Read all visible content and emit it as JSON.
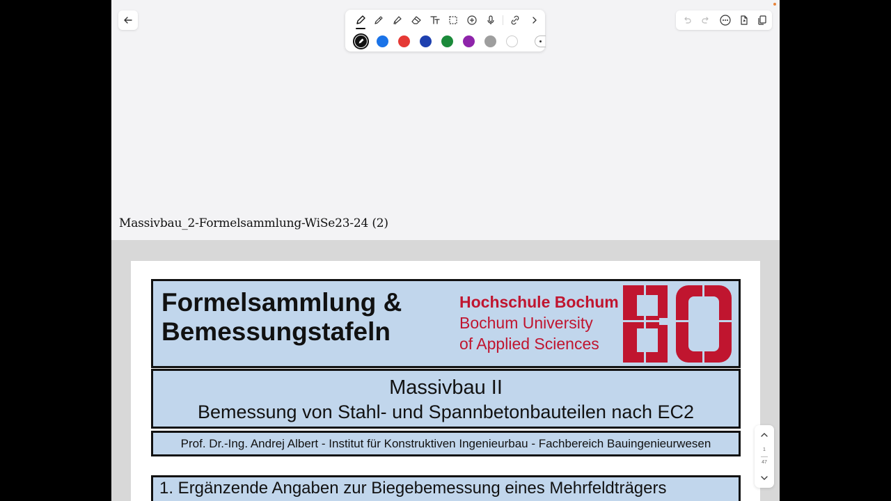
{
  "toolbar": {
    "tools": [
      "pen-tool",
      "pencil-tool",
      "highlighter-tool",
      "eraser-tool",
      "text-tool",
      "lasso-select-tool",
      "add-shape-tool",
      "microphone-tool",
      "link-tool",
      "more-tools"
    ],
    "active_tool": "pen-tool",
    "colors": [
      "#111111",
      "#1a73e8",
      "#e53935",
      "#1e40af",
      "#1b8a3a",
      "#8e24aa",
      "#9e9e9e",
      "#ffffff"
    ],
    "selected_color": "#111111"
  },
  "document": {
    "title": "Massivbau_2-Formelsammlung-WiSe23-24 (2)"
  },
  "page": {
    "main_title_line1": "Formelsammlung &",
    "main_title_line2": "Bemessungstafeln",
    "institution_line1": "Hochschule Bochum",
    "institution_line2": "Bochum University",
    "institution_line3": "of Applied Sciences",
    "logo_text": "BO",
    "course_title": "Massivbau II",
    "course_subtitle": "Bemessung von Stahl- und Spannbetonbauteilen nach EC2",
    "authors": "Prof. Dr.-Ing. Andrej Albert  -  Institut für Konstruktiven Ingenieurbau  -  Fachbereich Bauingenieurwesen",
    "section_heading": "1. Ergänzende Angaben zur Biegebemessung eines Mehrfeldträgers",
    "brand_color": "#c0152f",
    "box_color": "#c1d6ec"
  },
  "pager": {
    "current": "1",
    "total": "47"
  }
}
